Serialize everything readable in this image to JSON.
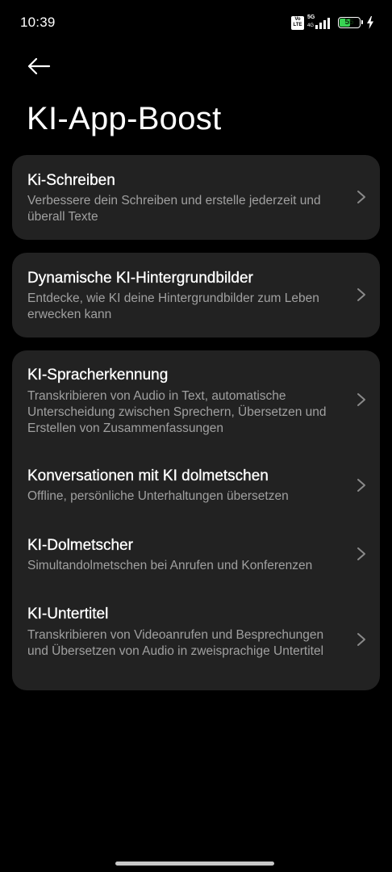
{
  "status_bar": {
    "time": "10:39",
    "volte_label": "Vo LTE",
    "network_label": "5G",
    "network_sub": "4G",
    "battery_percent": "55",
    "battery_level": 0.55,
    "battery_color": "#39d353"
  },
  "header": {
    "back_icon": "arrow-left-icon",
    "title": "KI-App-Boost"
  },
  "cards": [
    {
      "items": [
        {
          "title": "Ki-Schreiben",
          "description": "Verbessere dein Schreiben und erstelle jederzeit und überall Texte"
        }
      ]
    },
    {
      "items": [
        {
          "title": "Dynamische KI-Hintergrundbilder",
          "description": "Entdecke, wie KI deine Hintergrundbilder zum Leben erwecken kann"
        }
      ]
    },
    {
      "items": [
        {
          "title": "KI-Spracherkennung",
          "description": "Transkribieren von Audio in Text, automatische Unterscheidung zwischen Sprechern, Übersetzen und Erstellen von Zusammenfassungen"
        },
        {
          "title": "Konversationen mit KI dolmetschen",
          "description": "Offline, persönliche Unterhaltungen übersetzen"
        },
        {
          "title": "KI-Dolmetscher",
          "description": "Simultandolmetschen bei Anrufen und Konferenzen"
        },
        {
          "title": "KI-Untertitel",
          "description": "Transkribieren von Videoanrufen und Besprechungen und Übersetzen von Audio in zweisprachige Untertitel"
        }
      ]
    }
  ],
  "theme": {
    "background": "#000000",
    "card": "#222222",
    "title_text": "#ffffff",
    "secondary_text": "#a0a0a0",
    "chevron": "#8a8a8a"
  }
}
